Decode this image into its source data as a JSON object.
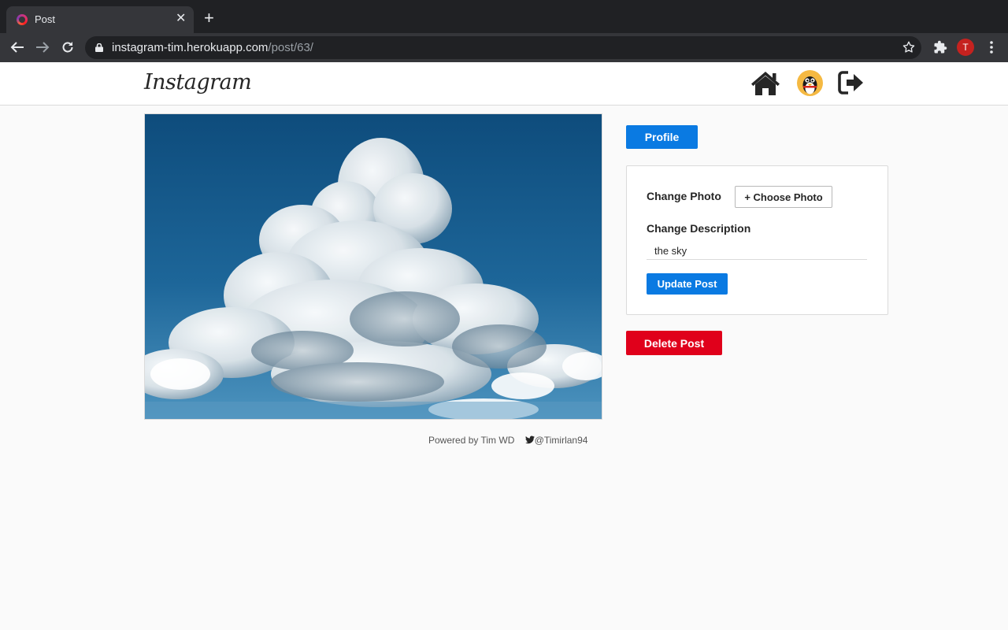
{
  "browser": {
    "tab_title": "Post",
    "url_host": "instagram-tim.herokuapp.com",
    "url_path": "/post/63/",
    "profile_initial": "T",
    "tab_close": "✕",
    "new_tab": "+",
    "icons": [
      "back-icon",
      "forward-icon",
      "reload-icon",
      "lock-icon",
      "star-icon",
      "extensions-icon",
      "menu-icon"
    ]
  },
  "header": {
    "logo": "Instagram",
    "icons": [
      "home-icon",
      "user-avatar",
      "logout-icon"
    ]
  },
  "post": {
    "image_alt": "",
    "description": "the sky"
  },
  "actions": {
    "profile_label": "Profile",
    "change_photo_label": "Change Photo",
    "choose_photo_label": "+ Choose Photo",
    "change_description_label": "Change Description",
    "update_label": "Update Post",
    "delete_label": "Delete Post"
  },
  "footer": {
    "powered_by": "Powered by Tim WD",
    "twitter": "@Timirlan94"
  },
  "colors": {
    "primary_button": "#0a7ae2",
    "danger_button": "#e0001b",
    "chrome_dark": "#202124"
  }
}
